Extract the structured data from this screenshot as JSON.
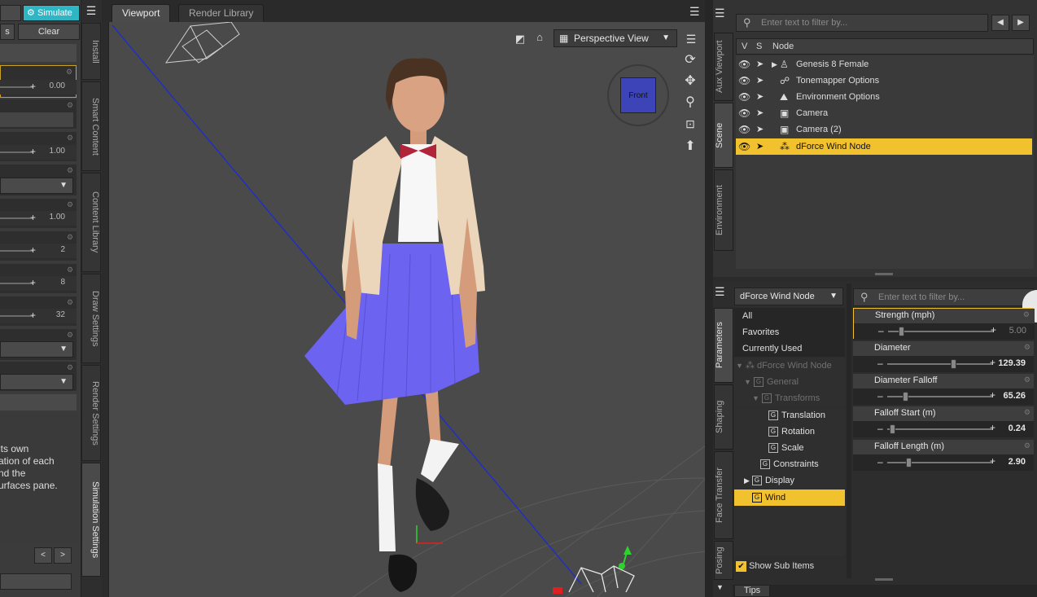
{
  "left_pane": {
    "simulate_button": "Simulate",
    "clear_button": "Clear",
    "slider_values": [
      "0.00",
      "1.00",
      "1.00",
      "2",
      "8",
      "32"
    ],
    "description_lines": [
      "its own",
      "ation of each",
      "nd the",
      "urfaces pane."
    ],
    "side_tabs": [
      "Install",
      "Smart Content",
      "Content Library",
      "Draw Settings",
      "Render Settings",
      "Simulation Settings"
    ]
  },
  "viewport": {
    "tabs": [
      "Viewport",
      "Render Library"
    ],
    "view_selector": "Perspective View",
    "cube_label": "Front"
  },
  "scene": {
    "side_tabs": [
      "Aux Viewport",
      "Scene",
      "Environment"
    ],
    "filter_placeholder": "Enter text to filter by...",
    "col_v": "V",
    "col_s": "S",
    "col_node": "Node",
    "nodes": [
      {
        "label": "Genesis 8 Female",
        "icon": "figure-icon"
      },
      {
        "label": "Tonemapper Options",
        "icon": "tonemapper-icon"
      },
      {
        "label": "Environment Options",
        "icon": "environment-icon"
      },
      {
        "label": "Camera",
        "icon": "camera-icon"
      },
      {
        "label": "Camera (2)",
        "icon": "camera-icon"
      },
      {
        "label": "dForce Wind Node",
        "icon": "wind-node-icon"
      }
    ]
  },
  "parameters": {
    "side_tabs": [
      "Parameters",
      "Shaping",
      "Face Transfer",
      "Posing"
    ],
    "node_selector": "dForce Wind Node",
    "filter_placeholder": "Enter text to filter by...",
    "tree": [
      {
        "label": "All"
      },
      {
        "label": "Favorites"
      },
      {
        "label": "Currently Used"
      },
      {
        "label": "dForce Wind Node"
      },
      {
        "label": "General"
      },
      {
        "label": "Transforms"
      },
      {
        "label": "Translation"
      },
      {
        "label": "Rotation"
      },
      {
        "label": "Scale"
      },
      {
        "label": "Constraints"
      },
      {
        "label": "Display"
      },
      {
        "label": "Wind"
      }
    ],
    "group_glyph": "G",
    "show_sub_items": "Show Sub Items",
    "tips_tab": "Tips",
    "properties": [
      {
        "name": "Strength (mph)",
        "value": "5.00",
        "fraction": 0.1
      },
      {
        "name": "Diameter",
        "value": "129.39",
        "fraction": 0.62
      },
      {
        "name": "Diameter Falloff",
        "value": "65.26",
        "fraction": 0.15
      },
      {
        "name": "Falloff Start (m)",
        "value": "0.24",
        "fraction": 0.02
      },
      {
        "name": "Falloff Length (m)",
        "value": "2.90",
        "fraction": 0.18
      }
    ]
  },
  "colors": {
    "selection": "#f2c12e",
    "simulate_button": "#2fb5c4",
    "skirt": "#6c63f0",
    "blazer": "#ecd6bb"
  }
}
